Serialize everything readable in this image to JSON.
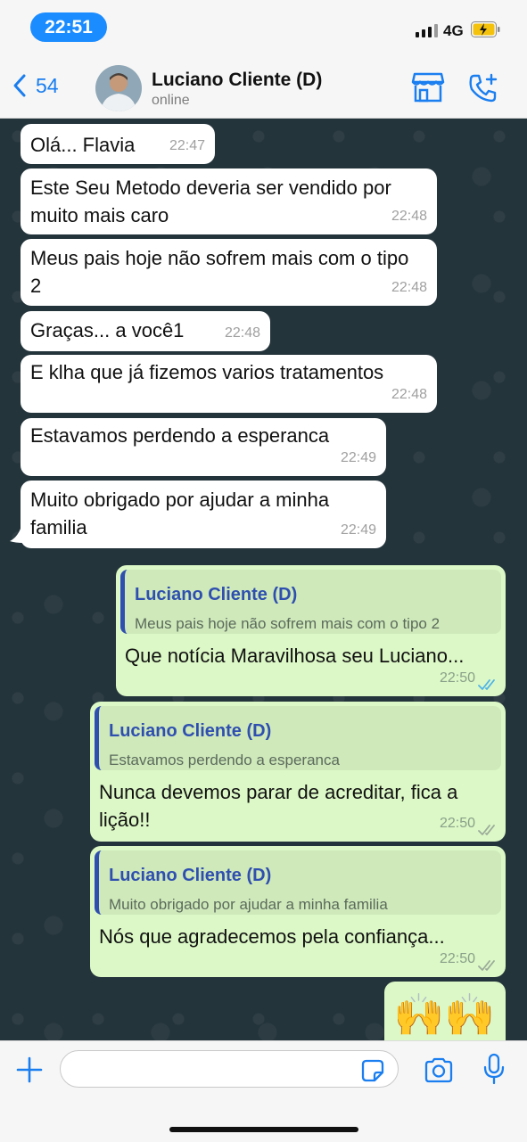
{
  "status_bar": {
    "time": "22:51",
    "network": "4G"
  },
  "header": {
    "back_count": "54",
    "contact_name": "Luciano Cliente (D)",
    "contact_status": "online"
  },
  "messages_in": [
    {
      "text": "Olá... Flavia",
      "time": "22:47"
    },
    {
      "text": "Este Seu Metodo deveria ser vendido por muito mais caro",
      "time": "22:48"
    },
    {
      "text": "Meus pais hoje não sofrem mais com o tipo 2",
      "time": "22:48"
    },
    {
      "text": "Graças... a você1",
      "time": "22:48"
    },
    {
      "text": "E klha que já fizemos varios tratamentos",
      "time": "22:48"
    },
    {
      "text": "Estavamos perdendo a esperanca",
      "time": "22:49"
    },
    {
      "text": "Muito obrigado por ajudar a minha familia",
      "time": "22:49"
    }
  ],
  "messages_out": [
    {
      "quote_name": "Luciano Cliente (D)",
      "quote_text": "Meus pais hoje não sofrem mais com o tipo 2",
      "text": "Que notícia Maravilhosa seu Luciano...",
      "time": "22:50"
    },
    {
      "quote_name": "Luciano Cliente (D)",
      "quote_text": "Estavamos perdendo a esperanca",
      "text": "Nunca devemos parar de acreditar, fica a lição!!",
      "time": "22:50"
    },
    {
      "quote_name": "Luciano Cliente (D)",
      "quote_text": "Muito obrigado por ajudar a minha familia",
      "text": "Nós que agradecemos pela confiança...",
      "time": "22:50"
    }
  ],
  "emoji_message": {
    "emoji": "🙌🙌"
  },
  "composer": {
    "placeholder": ""
  },
  "colors": {
    "accent_blue": "#1a7ef0",
    "outgoing_bubble": "#dcf8c6",
    "incoming_bubble": "#ffffff",
    "chat_background": "#24343b",
    "quote_name": "#2f4fb0"
  },
  "icons": [
    "back-chevron-icon",
    "store-icon",
    "add-call-icon",
    "plus-icon",
    "sticker-icon",
    "camera-icon",
    "microphone-icon",
    "read-ticks-icon"
  ]
}
